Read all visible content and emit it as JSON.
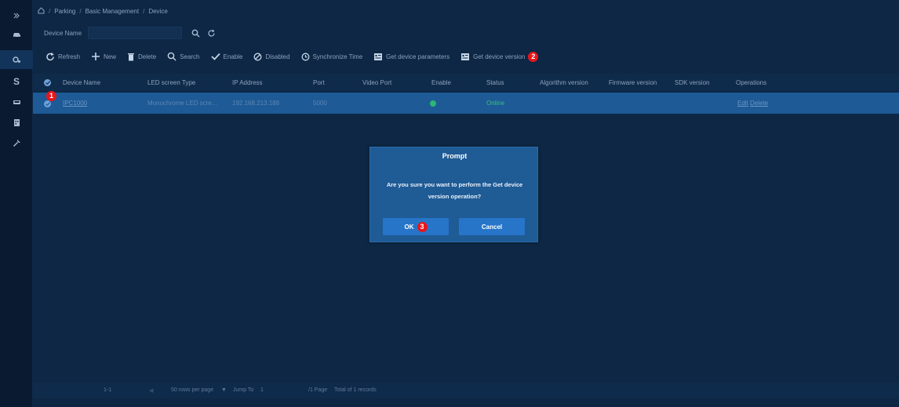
{
  "sidebar": {
    "icons": [
      "expand-icon",
      "car-icon",
      "settings-icon",
      "dollar-icon",
      "vehicle-icon",
      "building-icon",
      "tools-icon"
    ]
  },
  "breadcrumb": {
    "items": [
      "Parking",
      "Basic Management",
      "Device"
    ],
    "separator": "/"
  },
  "search": {
    "label": "Device Name",
    "value": ""
  },
  "toolbar": {
    "refresh": "Refresh",
    "new": "New",
    "delete": "Delete",
    "search": "Search",
    "enable": "Enable",
    "disabled": "Disabled",
    "sync_time": "Synchronize Time",
    "get_params": "Get device parameters",
    "get_version": "Get device version",
    "step_badge": "2"
  },
  "table": {
    "columns": [
      "Device Name",
      "LED screen Type",
      "IP Address",
      "Port",
      "Video Port",
      "Enable",
      "Status",
      "Algorithm version",
      "Firmware version",
      "SDK version",
      "Operations"
    ],
    "rows": [
      {
        "device_name": "IPC1000",
        "led_type": "Monochrome LED scre...",
        "ip": "192.168.213.188",
        "port": "5000",
        "video_port": "",
        "status": "Online",
        "op_edit": "Edit",
        "op_delete": "Delete",
        "step_badge": "1"
      }
    ]
  },
  "pagination": {
    "range": "1-1",
    "per_page": "50 rows per page",
    "jump_label": "Jump To",
    "jump_value": "1",
    "pages": "/1 Page",
    "total": "Total of 1 records"
  },
  "dialog": {
    "title": "Prompt",
    "message": "Are you sure you want to perform the Get device version operation?",
    "ok": "OK",
    "cancel": "Cancel",
    "step_badge": "3"
  },
  "colors": {
    "background": "#0b1e37",
    "selected_row": "#1d5a96",
    "dialog": "#1f5b95",
    "button": "#2775c9",
    "badge": "#e8161b",
    "online": "#2bb673"
  }
}
